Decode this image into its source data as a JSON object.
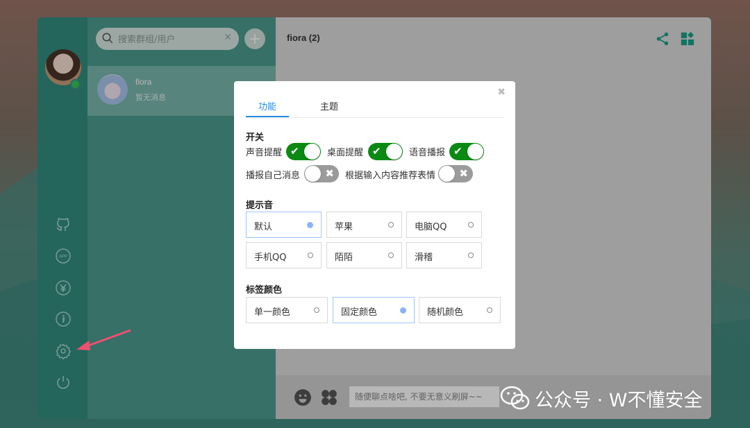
{
  "search": {
    "placeholder": "搜索群组/用户"
  },
  "contacts": [
    {
      "name": "fiora",
      "last_message": "暂无消息"
    }
  ],
  "chat": {
    "title": "fiora (2)",
    "input_placeholder": "随便聊点啥吧, 不要无意义刷屏~~"
  },
  "settings": {
    "tabs": [
      "功能",
      "主题"
    ],
    "switch_section": "开关",
    "switches": [
      {
        "label": "声音提醒",
        "on": true
      },
      {
        "label": "桌面提醒",
        "on": true
      },
      {
        "label": "语音播报",
        "on": true
      },
      {
        "label": "播报自己消息",
        "on": false
      },
      {
        "label": "根据输入内容推荐表情",
        "on": false
      }
    ],
    "sound_section": "提示音",
    "sounds": [
      {
        "label": "默认",
        "selected": true
      },
      {
        "label": "苹果",
        "selected": false
      },
      {
        "label": "电脑QQ",
        "selected": false
      },
      {
        "label": "手机QQ",
        "selected": false
      },
      {
        "label": "陌陌",
        "selected": false
      },
      {
        "label": "滑稽",
        "selected": false
      }
    ],
    "tag_color_section": "标签颜色",
    "tag_colors": [
      {
        "label": "单一颜色",
        "selected": false
      },
      {
        "label": "固定颜色",
        "selected": true
      },
      {
        "label": "随机颜色",
        "selected": false
      }
    ]
  },
  "sidebar_icons": [
    "github-icon",
    "app-icon",
    "yen-icon",
    "info-icon",
    "gear-icon",
    "power-icon"
  ],
  "watermark": {
    "text": "公众号 · W不懂安全"
  },
  "colors": {
    "accent": "#2a8ee0",
    "toggle_on": "#0a8a13",
    "toggle_off": "#9b9b9b",
    "arrow": "#f0506e"
  }
}
